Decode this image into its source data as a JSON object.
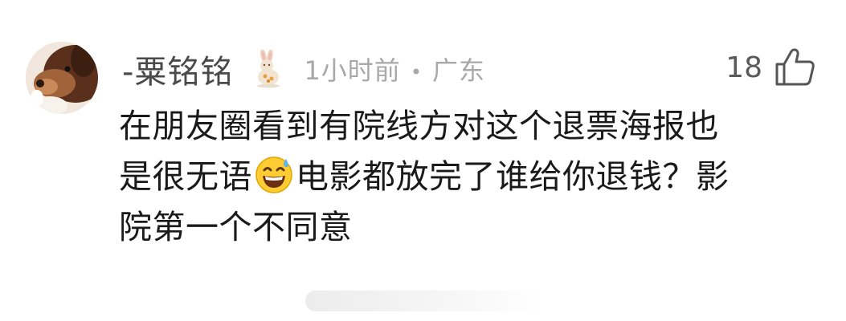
{
  "comment": {
    "author": "-粟铭铭",
    "badge_icon": "rabbit-badge-icon",
    "time": "1小时前",
    "separator": "•",
    "location": "广东",
    "likes": "18",
    "like_icon": "thumbs-up-icon",
    "text_lines": [
      "在朋友圈看到有院线方对这个退票海报也",
      "是很无语",
      "电影都放完了谁给你退钱？影",
      "院第一个不同意"
    ],
    "emoji": "sweat-smile-emoji-icon"
  },
  "colors": {
    "author": "#4a4a4a",
    "meta": "#a8a8a8",
    "text": "#1a1a1a",
    "likes": "#5a5a5a"
  }
}
